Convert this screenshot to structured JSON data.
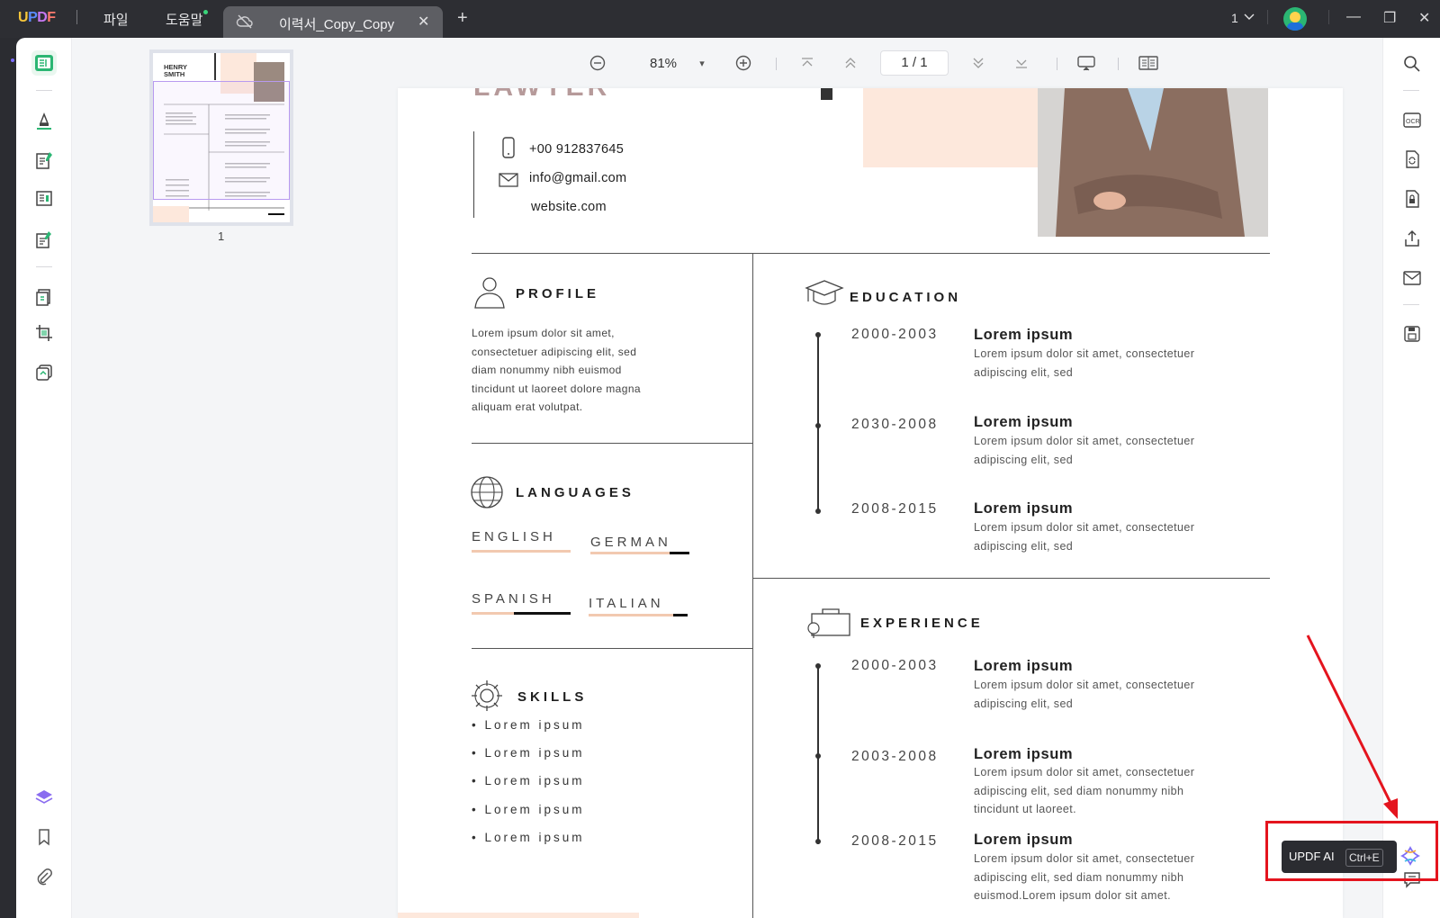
{
  "titlebar": {
    "menu_file": "파일",
    "menu_help": "도움말",
    "tab_title": "이력서_Copy_Copy",
    "tab_close": "✕",
    "new_tab": "+",
    "page_indicator": "1",
    "chevron": "⌵",
    "minimize": "—",
    "restore": "❐",
    "close": "✕"
  },
  "toolbar": {
    "zoom": "81%",
    "zoom_dropdown": "▾",
    "page": "1  /  1"
  },
  "thumbnail": {
    "label": "1",
    "name_line1": "HENRY",
    "name_line2": "SMITH"
  },
  "resume": {
    "job_title": "LAWYER",
    "phone": "+00 912837645",
    "email": "info@gmail.com",
    "website": "website.com",
    "profile": {
      "title": "PROFILE",
      "text": [
        "Lorem ipsum dolor sit amet,",
        "consectetuer adipiscing elit, sed",
        "diam nonummy nibh euismod",
        "tincidunt ut laoreet dolore magna",
        "aliquam erat volutpat."
      ]
    },
    "languages": {
      "title": "LANGUAGES",
      "items": [
        {
          "name": "ENGLISH",
          "level": 0.0
        },
        {
          "name": "GERMAN",
          "level": 0.2
        },
        {
          "name": "SPANISH",
          "level": 0.57
        },
        {
          "name": "ITALIAN",
          "level": 0.15
        }
      ]
    },
    "skills": {
      "title": "SKILLS",
      "items": [
        "Lorem ipsum",
        "Lorem ipsum",
        "Lorem ipsum",
        "Lorem ipsum",
        "Lorem ipsum"
      ]
    },
    "education": {
      "title": "EDUCATION",
      "entries": [
        {
          "years": "2000-2003",
          "title": "Lorem ipsum",
          "lines": [
            "Lorem ipsum dolor sit amet, consectetuer",
            "adipiscing elit, sed"
          ]
        },
        {
          "years": "2030-2008",
          "title": "Lorem ipsum",
          "lines": [
            "Lorem ipsum dolor sit amet, consectetuer",
            "adipiscing elit, sed"
          ]
        },
        {
          "years": "2008-2015",
          "title": "Lorem ipsum",
          "lines": [
            "Lorem ipsum dolor sit amet, consectetuer",
            "adipiscing elit, sed"
          ]
        }
      ]
    },
    "experience": {
      "title": "EXPERIENCE",
      "entries": [
        {
          "years": "2000-2003",
          "title": "Lorem ipsum",
          "lines": [
            "Lorem ipsum dolor sit amet, consectetuer",
            "adipiscing elit, sed"
          ]
        },
        {
          "years": "2003-2008",
          "title": "Lorem ipsum",
          "lines": [
            "Lorem ipsum dolor sit amet, consectetuer",
            "adipiscing elit, sed diam nonummy nibh",
            "tincidunt ut laoreet."
          ]
        },
        {
          "years": "2008-2015",
          "title": "Lorem ipsum",
          "lines": [
            "Lorem ipsum dolor sit amet, consectetuer",
            "adipiscing elit, sed diam nonummy nibh",
            "euismod.Lorem ipsum dolor sit amet."
          ]
        }
      ]
    }
  },
  "ai": {
    "label": "UPDF AI",
    "shortcut": "Ctrl+E"
  },
  "colors": {
    "accent_green": "#2bb673",
    "highlight_red": "#e4141e",
    "peach": "#f2c9b0"
  }
}
